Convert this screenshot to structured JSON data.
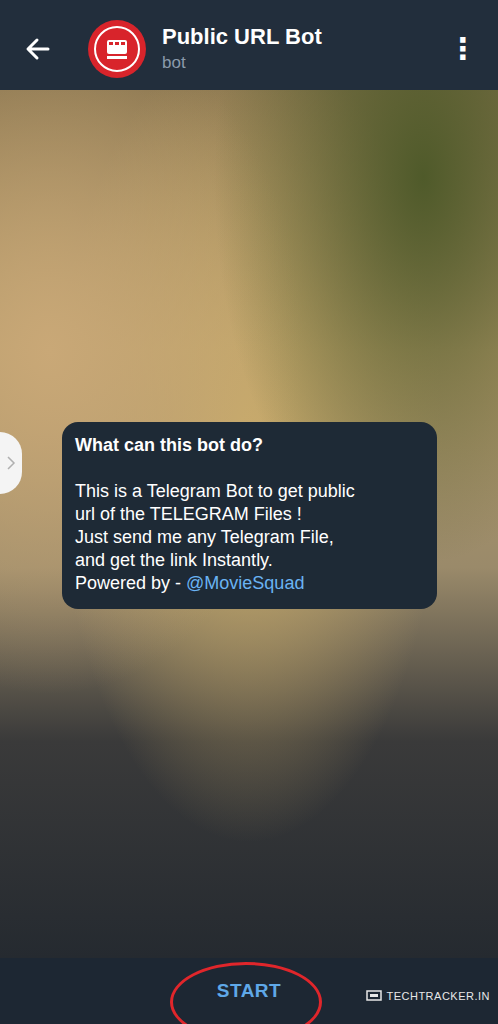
{
  "header": {
    "title": "Public URL Bot",
    "subtitle": "bot",
    "menu_icon": "⋮"
  },
  "bot_info": {
    "heading": "What can this bot do?",
    "lines": [
      "This is a Telegram Bot to get public",
      "url of the TELEGRAM Files !",
      "Just send me any Telegram File,",
      "and get the link Instantly."
    ],
    "credit": {
      "prefix": "Powered by - ",
      "link": "@MovieSquad"
    }
  },
  "start_button": {
    "label": "START"
  },
  "watermark": {
    "text": "TECHTRACKER.IN"
  }
}
